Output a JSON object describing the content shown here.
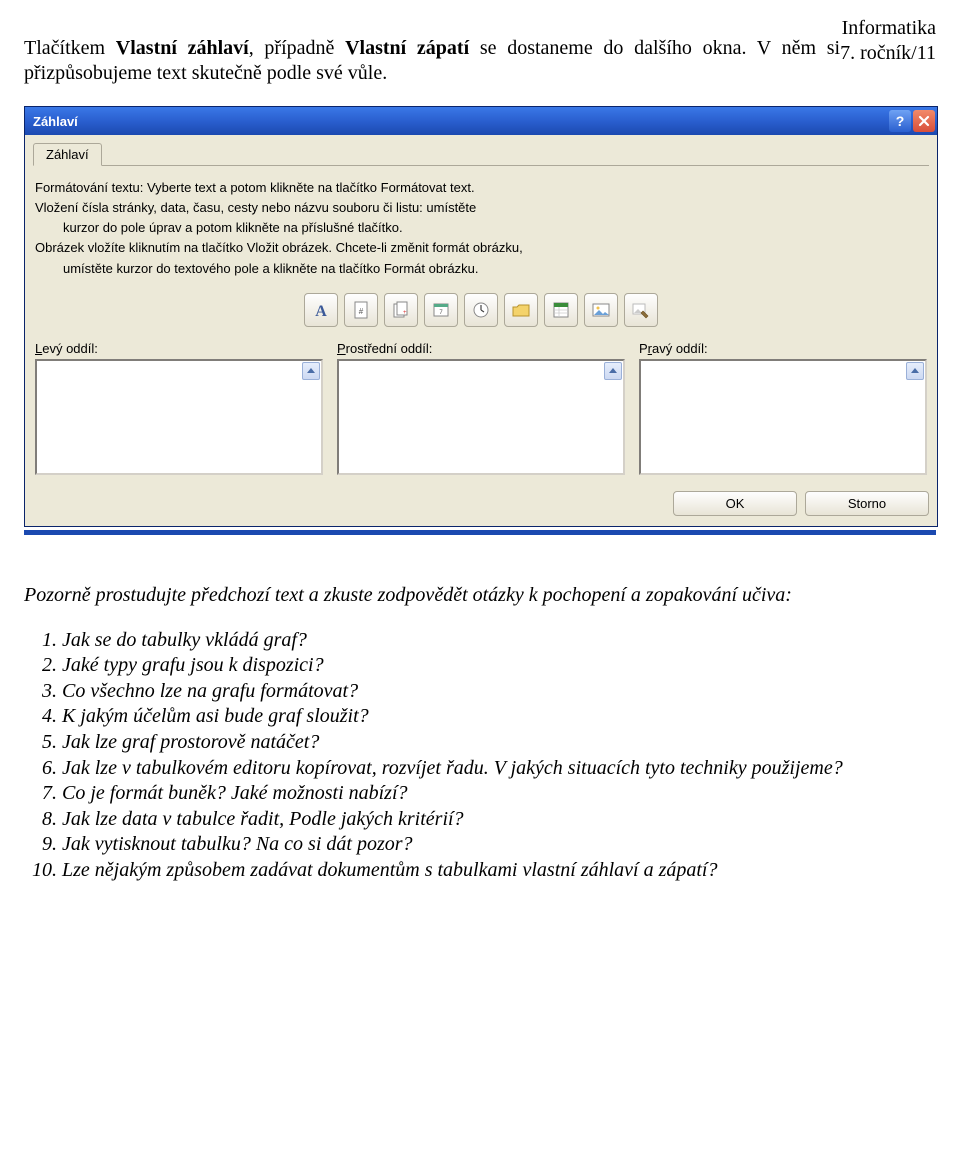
{
  "header": {
    "subject": "Informatika",
    "grade": "7. ročník/11"
  },
  "intro": {
    "part1": "Tlačítkem ",
    "bold1": "Vlastní záhlaví",
    "part2": ", případně ",
    "bold2": "Vlastní zápatí",
    "part3": " se dostaneme do dalšího okna. V něm si přizpůsobujeme text skutečně podle své vůle."
  },
  "dialog": {
    "title": "Záhlaví",
    "tab_label": "Záhlaví",
    "instructions": {
      "l1": "Formátování textu: Vyberte text a potom klikněte na tlačítko Formátovat text.",
      "l2": "Vložení čísla stránky, data, času, cesty nebo názvu souboru či listu: umístěte",
      "l3": "kurzor do pole úprav a potom klikněte na příslušné tlačítko.",
      "l4": "Obrázek vložíte kliknutím na tlačítko Vložit obrázek. Chcete-li změnit formát obrázku,",
      "l5": "umístěte kurzor do textového pole a klikněte na tlačítko Formát obrázku."
    },
    "icons": {
      "font": "font-icon",
      "page": "page-number-icon",
      "pages": "pages-icon",
      "date": "date-icon",
      "time": "time-icon",
      "path": "path-icon",
      "sheet": "sheet-icon",
      "picture": "picture-icon",
      "format_pic": "format-picture-icon"
    },
    "sections": {
      "left_pre": "L",
      "left_rest": "evý oddíl:",
      "center_pre": "P",
      "center_rest": "rostřední oddíl:",
      "right_pre": "P",
      "right_u": "r",
      "right_rest": "avý oddíl:"
    },
    "buttons": {
      "ok": "OK",
      "cancel": "Storno"
    }
  },
  "study": {
    "intro": "Pozorně prostudujte předchozí text a zkuste zodpovědět otázky k pochopení a zopakování učiva:",
    "q1": "Jak se do tabulky vkládá graf?",
    "q2": "Jaké typy grafu jsou k dispozici?",
    "q3": "Co všechno lze na grafu formátovat?",
    "q4": "K jakým účelům asi bude graf sloužit?",
    "q5": "Jak lze graf prostorově natáčet?",
    "q6": "Jak lze v tabulkovém editoru kopírovat, rozvíjet řadu. V jakých situacích tyto techniky použijeme?",
    "q7": "Co je formát buněk? Jaké možnosti nabízí?",
    "q8": "Jak lze data v tabulce řadit, Podle jakých kritérií?",
    "q9": "Jak vytisknout tabulku? Na co si dát pozor?",
    "q10": "Lze nějakým způsobem zadávat dokumentům s tabulkami vlastní záhlaví a zápatí?"
  }
}
